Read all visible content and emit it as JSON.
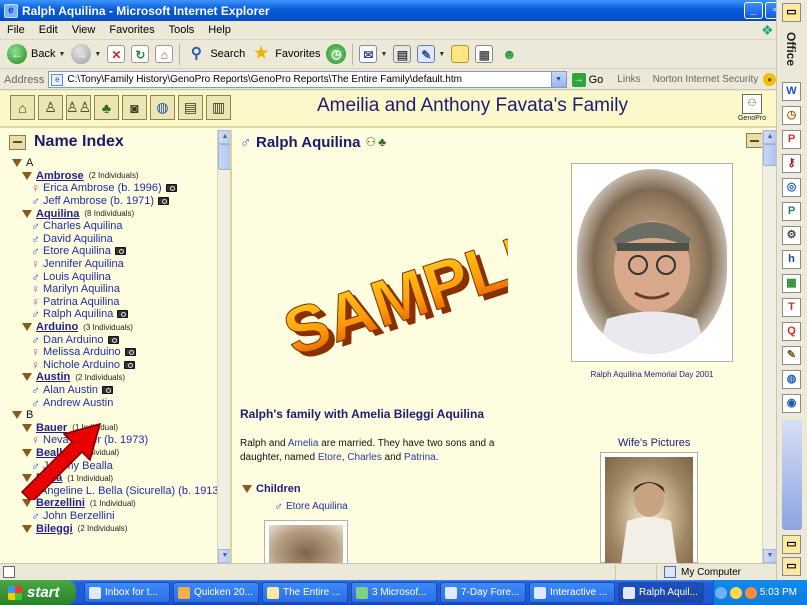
{
  "window": {
    "title": "Ralph Aquilina - Microsoft Internet Explorer"
  },
  "menu": [
    "File",
    "Edit",
    "View",
    "Favorites",
    "Tools",
    "Help"
  ],
  "toolbar": {
    "back": "Back",
    "search": "Search",
    "favorites": "Favorites"
  },
  "address": {
    "label": "Address",
    "url": "C:\\Tony\\Family History\\GenoPro Reports\\GenoPro Reports\\The Entire Family\\default.htm",
    "go": "Go",
    "links": "Links",
    "norton": "Norton Internet Security"
  },
  "page": {
    "family_title": "Ameilia and Anthony Favata's Family",
    "genopro": "GenoPro"
  },
  "index": {
    "title": "Name Index",
    "rows": [
      {
        "t": "letter",
        "text": "A"
      },
      {
        "t": "surname",
        "text": "Ambrose",
        "count": "(2 Individuals)"
      },
      {
        "t": "person",
        "g": "f",
        "text": "Erica Ambrose (b. 1996)",
        "cam": true
      },
      {
        "t": "person",
        "g": "m",
        "text": "Jeff Ambrose (b. 1971)",
        "cam": true
      },
      {
        "t": "surname",
        "text": "Aquilina",
        "count": "(8 Individuals)"
      },
      {
        "t": "person",
        "g": "m",
        "text": "Charles Aquilina",
        "cam": false
      },
      {
        "t": "person",
        "g": "m",
        "text": "David Aquilina",
        "cam": false
      },
      {
        "t": "person",
        "g": "m",
        "text": "Etore Aquilina",
        "cam": true
      },
      {
        "t": "person",
        "g": "f",
        "text": "Jennifer Aquilina",
        "cam": false
      },
      {
        "t": "person",
        "g": "m",
        "text": "Louis Aquilina",
        "cam": false
      },
      {
        "t": "person",
        "g": "f",
        "text": "Marilyn Aquilina",
        "cam": false
      },
      {
        "t": "person",
        "g": "f",
        "text": "Patrina Aquilina",
        "cam": false
      },
      {
        "t": "person",
        "g": "m",
        "text": "Ralph Aquilina",
        "cam": true
      },
      {
        "t": "surname",
        "text": "Arduino",
        "count": "(3 Individuals)"
      },
      {
        "t": "person",
        "g": "m",
        "text": "Dan Arduino",
        "cam": true
      },
      {
        "t": "person",
        "g": "f",
        "text": "Melissa Arduino",
        "cam": true
      },
      {
        "t": "person",
        "g": "f",
        "text": "Nichole Arduino",
        "cam": true
      },
      {
        "t": "surname",
        "text": "Austin",
        "count": "(2 Individuals)"
      },
      {
        "t": "person",
        "g": "m",
        "text": "Alan Austin",
        "cam": true
      },
      {
        "t": "person",
        "g": "m",
        "text": "Andrew Austin",
        "cam": false
      },
      {
        "t": "letter",
        "text": "B"
      },
      {
        "t": "surname",
        "text": "Bauer",
        "count": "(1 Individual)"
      },
      {
        "t": "person",
        "g": "f",
        "text": "Neva Bauer (b. 1973)",
        "cam": false
      },
      {
        "t": "surname",
        "text": "Bealla",
        "count": "(1 Individual)"
      },
      {
        "t": "person",
        "g": "m",
        "text": "Jeremy Bealla",
        "cam": false
      },
      {
        "t": "surname",
        "text": "Bella",
        "count": "(1 Individual)"
      },
      {
        "t": "person",
        "g": "f",
        "text": "Angeline L. Bella (Sicurella) (b. 1913)",
        "cam": false
      },
      {
        "t": "surname",
        "text": "Berzellini",
        "count": "(1 Individual)"
      },
      {
        "t": "person",
        "g": "m",
        "text": "John Berzellini",
        "cam": false
      },
      {
        "t": "surname",
        "text": "Bileggi",
        "count": "(2 Individuals)"
      }
    ]
  },
  "person": {
    "name": "Ralph Aquilina",
    "watermark": "SAMPLE",
    "photo_caption": "Ralph Aquilina Memorial Day 2001",
    "family_heading": "Ralph's family with Amelia Bileggi Aquilina",
    "family_text_1": "Ralph and ",
    "spouse": "Amelia",
    "family_text_2": " are married.  They have two sons and a daughter, named ",
    "child_1": "Etore",
    "sep_1": ", ",
    "child_2": "Charles",
    "sep_2": " and ",
    "child_3": "Patrina",
    "period": ".",
    "wife_pictures": "Wife's Pictures",
    "children_title": "Children",
    "child_name": "Etore Aquilina"
  },
  "status": {
    "zone": "My Computer"
  },
  "office": {
    "label": "Office"
  },
  "taskbar": {
    "start": "start",
    "tasks": [
      "Inbox for t...",
      "Quicken 20...",
      "The Entire ...",
      "3 Microsof...",
      "7-Day Fore...",
      "Interactive ...",
      "Ralph Aquil..."
    ],
    "clock": "5:03 PM"
  },
  "colors": {
    "page_bg": "#fffde0",
    "title_blue": "#1c1c75",
    "link_blue": "#1f2ea8",
    "male": "#2c5fd1",
    "female": "#d03a8f"
  }
}
